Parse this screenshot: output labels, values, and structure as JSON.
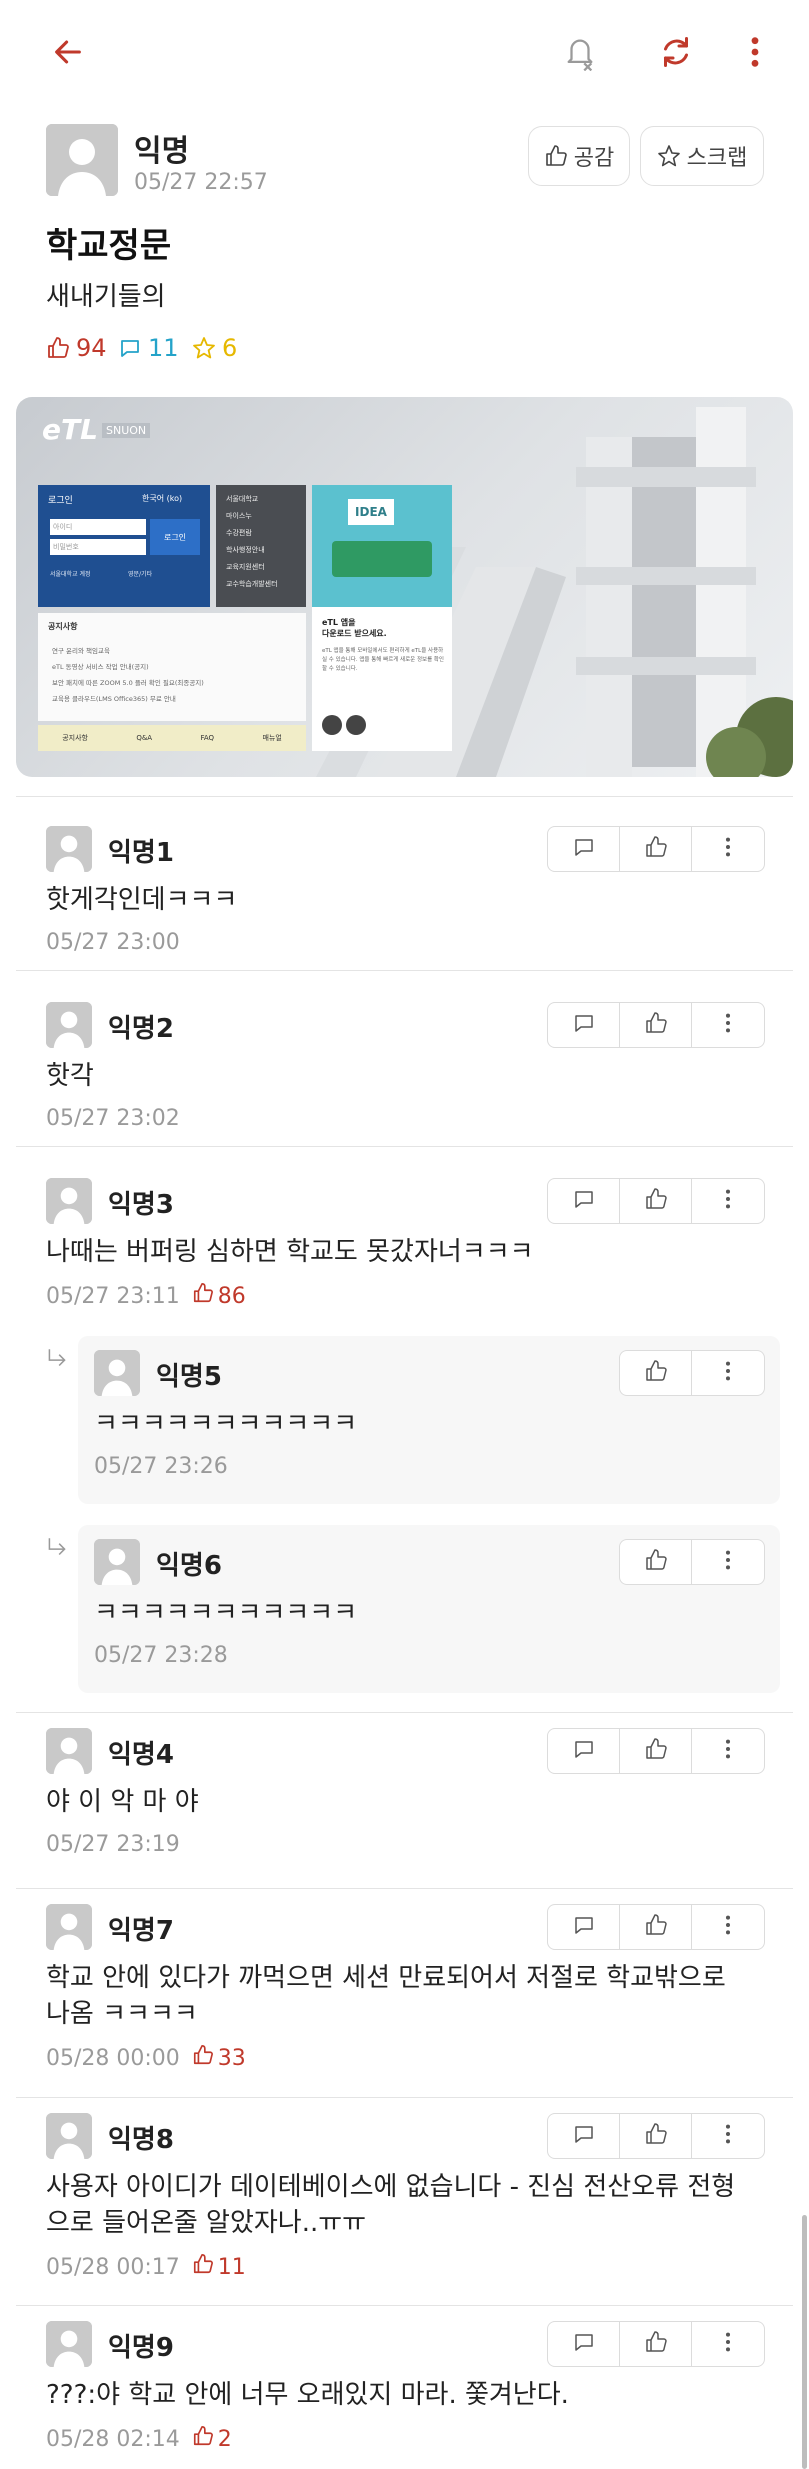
{
  "colors": {
    "accent": "#c0392b",
    "comment": "#24a3c9",
    "scrap": "#e6b800"
  },
  "topbar": {
    "back_icon": "arrow-left-icon",
    "bell_icon": "bell-off-icon",
    "refresh_icon": "refresh-icon",
    "more_icon": "more-vertical-icon"
  },
  "post": {
    "author": "익명",
    "time": "05/27 22:57",
    "like_button": "공감",
    "scrap_button": "스크랩",
    "title": "학교정문",
    "body": "새내기들의",
    "likes": "94",
    "comments": "11",
    "scraps": "6",
    "image": {
      "logo": "eTL",
      "logo_sub": "SNUON",
      "login_title": "로그인",
      "login_lang": "한국어 (ko)",
      "login_id": "아이디",
      "login_pw": "비밀번호",
      "login_btn": "로그인",
      "login_opt1": "서울대학교 계정",
      "login_opt2": "영문/기타",
      "menu": [
        "서울대학교",
        "마이스누",
        "수강편람",
        "학사행정안내",
        "교육지원센터",
        "교수학습개발센터"
      ],
      "notice_title": "공지사항",
      "notices": [
        "연구 윤리와 책임교육",
        "eTL 동영상 서비스 작업 안내(공지)",
        "보안 패치에 따른 ZOOM 5.0 플러 확인 필요(최종공지)",
        "교육용 클라우드(LMS Office365) 무료 안내"
      ],
      "tabs": [
        "공지사항",
        "Q&A",
        "FAQ",
        "매뉴얼"
      ],
      "app_badge": "IDEA",
      "app_title": "eTL 앱을\n다운로드 받으세요.",
      "app_desc": "eTL 앱을 통해 모바일에서도 편리하게 eTL을 사용하실 수 있습니다. 앱을 통해 빠르게 새로운 정보를 확인할 수 있습니다."
    }
  },
  "comments": [
    {
      "name": "익명1",
      "text": "핫게각인데ㅋㅋㅋ",
      "time": "05/27 23:00",
      "likes": ""
    },
    {
      "name": "익명2",
      "text": "핫각",
      "time": "05/27 23:02",
      "likes": ""
    },
    {
      "name": "익명3",
      "text": "나때는 버퍼링 심하면 학교도 못갔자너ㅋㅋㅋ",
      "time": "05/27 23:11",
      "likes": "86"
    },
    {
      "name": "익명5",
      "text": "ㅋㅋㅋㅋㅋㅋㅋㅋㅋㅋㅋ",
      "time": "05/27 23:26",
      "likes": ""
    },
    {
      "name": "익명6",
      "text": "ㅋㅋㅋㅋㅋㅋㅋㅋㅋㅋㅋ",
      "time": "05/27 23:28",
      "likes": ""
    },
    {
      "name": "익명4",
      "text": "야 이 악 마 야",
      "time": "05/27 23:19",
      "likes": ""
    },
    {
      "name": "익명7",
      "text": "학교 안에 있다가 까먹으면 세션 만료되어서 저절로 학교밖으로 나옴 ㅋㅋㅋㅋ",
      "time": "05/28 00:00",
      "likes": "33"
    },
    {
      "name": "익명8",
      "text": "사용자 아이디가 데이테베이스에 없습니다 - 진심 전산오류 전형으로 들어온줄 알았자나..ㅠㅠ",
      "time": "05/28 00:17",
      "likes": "11"
    },
    {
      "name": "익명9",
      "text": "???:야 학교 안에 너무 오래있지 마라. 쫓겨난다.",
      "time": "05/28 02:14",
      "likes": "2"
    }
  ]
}
